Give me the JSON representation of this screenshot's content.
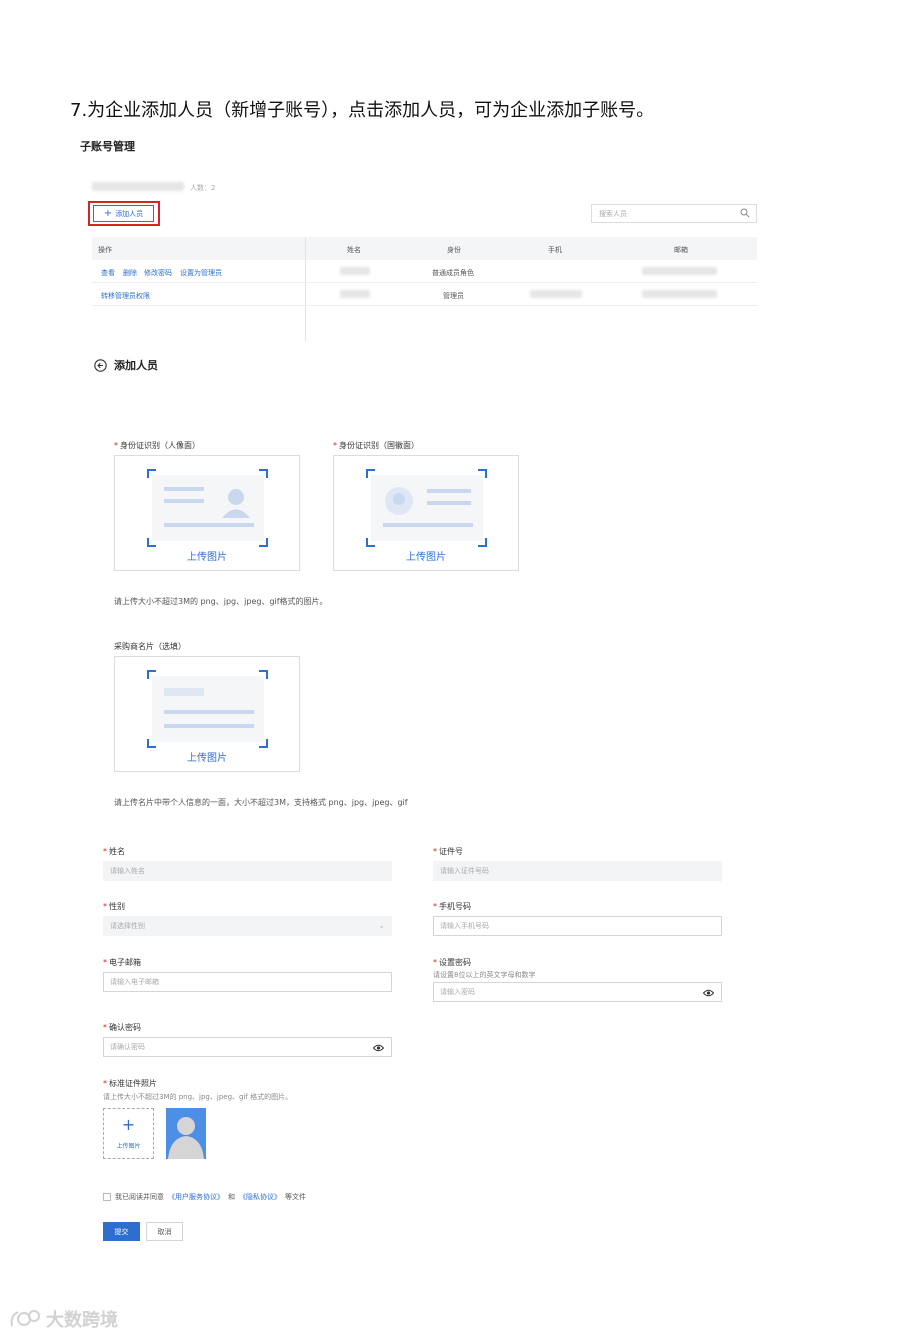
{
  "heading": "7.为企业添加人员（新增子账号），点击添加人员，可为企业添加子账号。",
  "subaccount": {
    "title": "子账号管理",
    "count_label": "人数：2",
    "add_button": "添加人员",
    "search_placeholder": "搜索人员",
    "columns": [
      "操作",
      "姓名",
      "身份",
      "手机",
      "邮箱"
    ],
    "rows": [
      {
        "actions": [
          "查看",
          "删除",
          "修改密码",
          "设置为管理员"
        ],
        "role": "普通成员角色"
      },
      {
        "actions": [
          "转移管理员权限"
        ],
        "role": "管理员"
      }
    ]
  },
  "add_person": {
    "title": "添加人员",
    "id_front_label": "身份证识别（人像面）",
    "id_back_label": "身份证识别（国徽面）",
    "upload_text": "上传图片",
    "id_hint": "请上传大小不超过3M的 png、jpg、jpeg、gif格式的图片。",
    "card_label": "采购商名片（选填）",
    "card_hint": "请上传名片中带个人信息的一面，大小不超过3M，支持格式 png、jpg、jpeg、gif"
  },
  "form": {
    "name_label": "姓名",
    "name_placeholder": "请输入姓名",
    "idno_label": "证件号",
    "idno_placeholder": "请输入证件号码",
    "gender_label": "性别",
    "gender_placeholder": "请选择性别",
    "phone_label": "手机号码",
    "phone_placeholder": "请输入手机号码",
    "email_label": "电子邮箱",
    "email_placeholder": "请输入电子邮箱",
    "password_label": "设置密码",
    "password_hint": "请设置8位以上的英文字母和数字",
    "password_placeholder": "请输入密码",
    "confirm_label": "确认密码",
    "confirm_placeholder": "请确认密码",
    "photo_label": "标准证件照片",
    "photo_hint": "请上传大小不超过3M的 png、jpg、jpeg、gif 格式的图片。",
    "photo_upload": "上传图片",
    "agree_prefix": "我已阅读并同意",
    "agree_link1": "《用户服务协议》",
    "agree_and": "和",
    "agree_link2": "《隐私协议》",
    "agree_suffix": "等文件",
    "submit": "提交",
    "cancel": "取消"
  },
  "watermark": "大数跨境",
  "colors": {
    "accent": "#2d6ecf",
    "highlight": "#d42424"
  }
}
